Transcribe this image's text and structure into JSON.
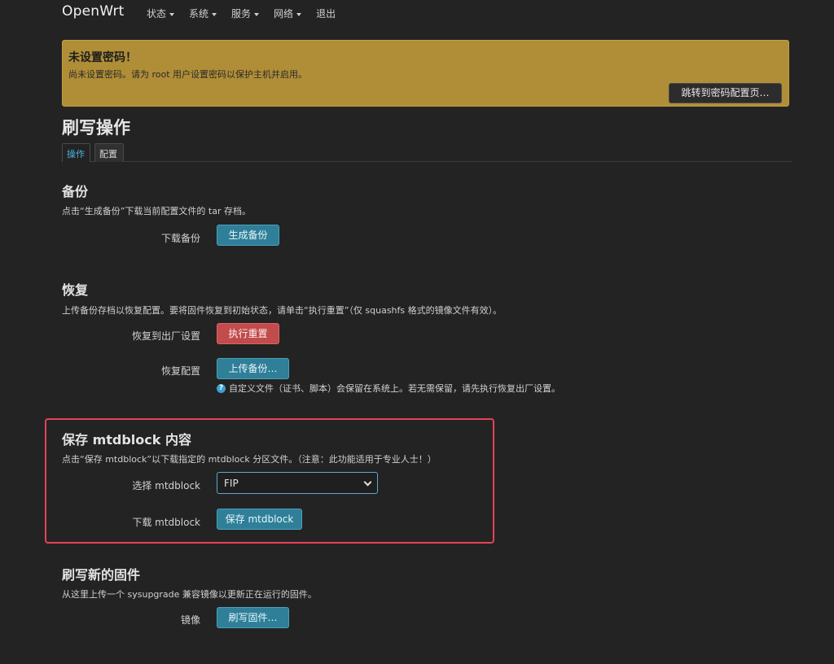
{
  "navbar": {
    "brand": "OpenWrt",
    "menu": [
      {
        "label": "状态",
        "dropdown": true
      },
      {
        "label": "系统",
        "dropdown": true
      },
      {
        "label": "服务",
        "dropdown": true
      },
      {
        "label": "网络",
        "dropdown": true
      },
      {
        "label": "退出",
        "dropdown": false
      }
    ]
  },
  "alert": {
    "title": "未设置密码！",
    "text": "尚未设置密码。请为 root 用户设置密码以保护主机并启用。",
    "button": "跳转到密码配置页…"
  },
  "page": {
    "title": "刷写操作",
    "tabs": [
      {
        "label": "操作",
        "active": true
      },
      {
        "label": "配置",
        "active": false
      }
    ]
  },
  "backup": {
    "title": "备份",
    "desc": "点击“生成备份”下载当前配置文件的 tar 存档。",
    "label": "下载备份",
    "button": "生成备份"
  },
  "restore": {
    "title": "恢复",
    "desc": "上传备份存档以恢复配置。要将固件恢复到初始状态，请单击“执行重置”（仅 squashfs 格式的镜像文件有效）。",
    "reset_label": "恢复到出厂设置",
    "reset_button": "执行重置",
    "upload_label": "恢复配置",
    "upload_button": "上传备份…",
    "hint": "自定义文件（证书、脚本）会保留在系统上。若无需保留，请先执行恢复出厂设置。"
  },
  "mtdblock": {
    "title": "保存 mtdblock 内容",
    "desc": "点击“保存 mtdblock”以下载指定的 mtdblock 分区文件。（注意：此功能适用于专业人士！）",
    "select_label": "选择 mtdblock",
    "select_value": "FIP",
    "download_label": "下载 mtdblock",
    "download_button": "保存 mtdblock"
  },
  "firmware": {
    "title": "刷写新的固件",
    "desc": "从这里上传一个 sysupgrade 兼容镜像以更新正在运行的固件。",
    "label": "镜像",
    "button": "刷写固件…"
  },
  "colors": {
    "background": "#232324",
    "alert": "#b08e37",
    "primary_button": "#2f7f98",
    "danger_button": "#c24b4b",
    "highlight_border": "#e94158",
    "active_tab": "#4fb4e2"
  }
}
